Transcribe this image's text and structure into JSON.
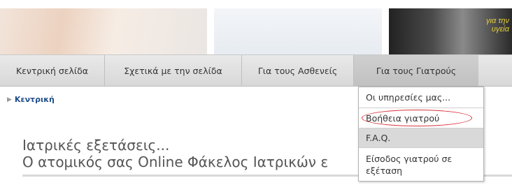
{
  "banner": {
    "overlay_text": "για την\nυγεία"
  },
  "menu": {
    "items": [
      {
        "label": "Κεντρική σελίδα"
      },
      {
        "label": "Σχετικά με την σελίδα"
      },
      {
        "label": "Για τους Ασθενείς"
      },
      {
        "label": "Για τους Γιατρούς",
        "active": true
      }
    ]
  },
  "breadcrumb": {
    "label": "Κεντρική"
  },
  "page": {
    "title_line1": "Ιατρικές εξετάσεις...",
    "title_line2": "Ο ατομικός σας Online Φάκελος Ιατρικών ε"
  },
  "dropdown": {
    "items": [
      {
        "label": "Οι υπηρεσίες μας..."
      },
      {
        "label": "Βοήθεια γιατρού",
        "circled": true
      },
      {
        "label": "F.A.Q.",
        "hover": true
      },
      {
        "label": "Είσοδος γιατρού σε εξέταση"
      }
    ]
  },
  "colors": {
    "menu_bg": "#dedede",
    "active_menu_bg": "#c6c6c6",
    "breadcrumb_link": "#1f4e8a",
    "circle_highlight": "#d9333a"
  }
}
